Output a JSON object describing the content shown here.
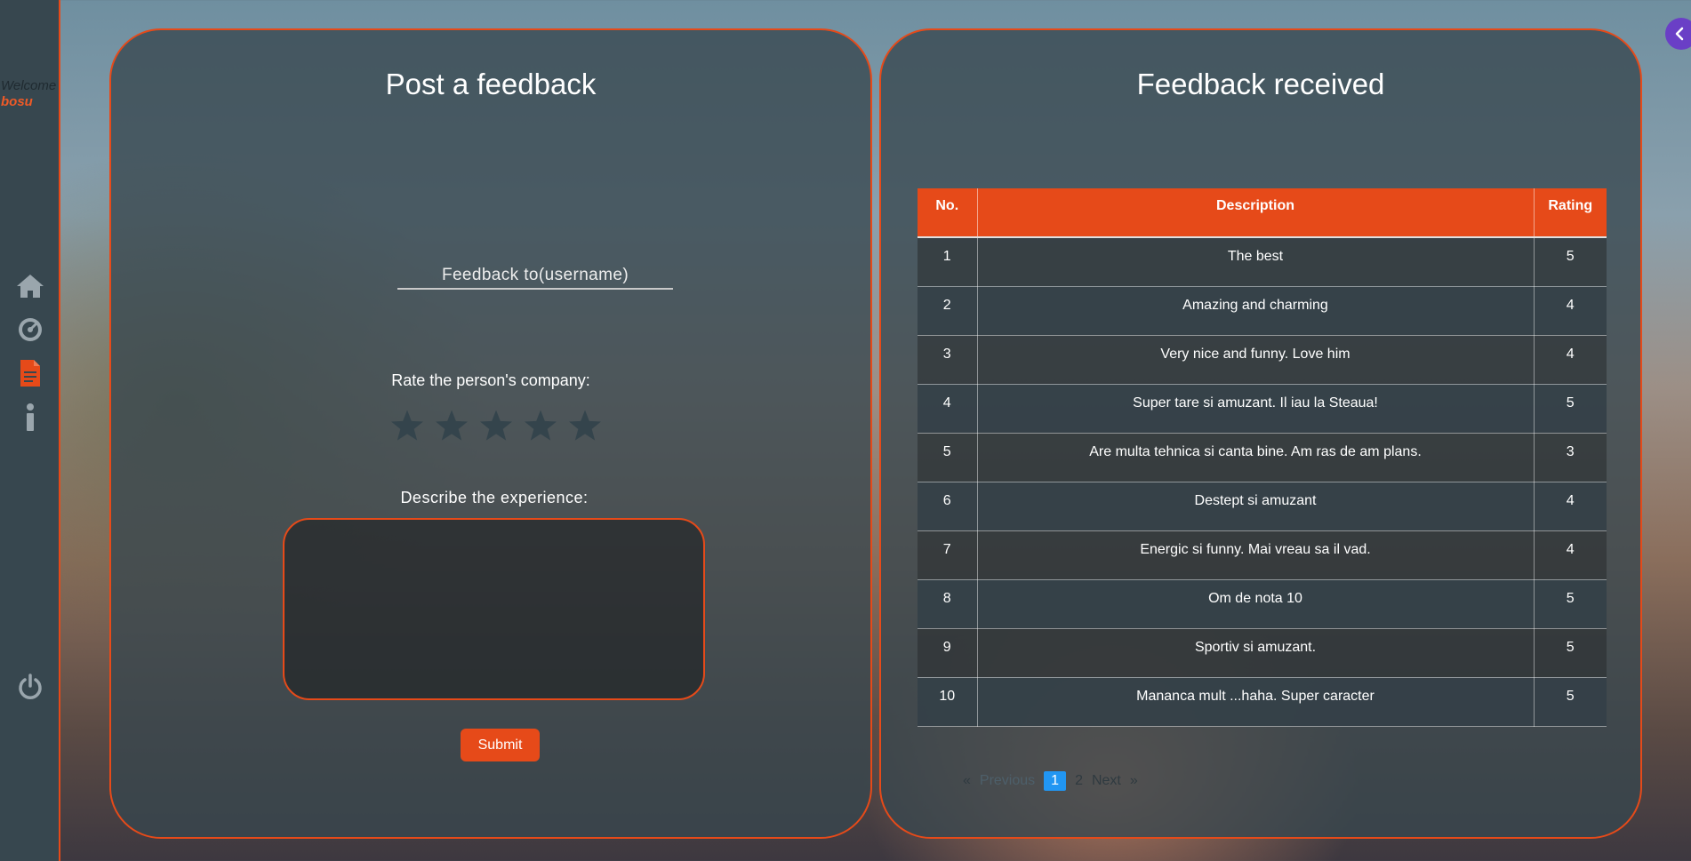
{
  "sidebar": {
    "welcome": "Welcome",
    "username": "bosu",
    "icons": [
      "home-icon",
      "dashboard-gauge-icon",
      "document-icon",
      "info-icon",
      "power-icon"
    ],
    "active_color": "#e64a19"
  },
  "post": {
    "title": "Post a feedback",
    "to_placeholder": "Feedback to(username)",
    "rate_label": "Rate the person's company:",
    "stars": 5,
    "describe_label": "Describe the experience:",
    "submit_label": "Submit"
  },
  "received": {
    "title": "Feedback received",
    "headers": {
      "no": "No.",
      "description": "Description",
      "rating": "Rating"
    },
    "rows": [
      {
        "no": "1",
        "description": "The best",
        "rating": "5"
      },
      {
        "no": "2",
        "description": "Amazing and charming",
        "rating": "4"
      },
      {
        "no": "3",
        "description": "Very nice and funny. Love him",
        "rating": "4"
      },
      {
        "no": "4",
        "description": "Super tare si amuzant. Il iau la Steaua!",
        "rating": "5"
      },
      {
        "no": "5",
        "description": "Are multa tehnica si canta bine. Am ras de am plans.",
        "rating": "3"
      },
      {
        "no": "6",
        "description": "Destept si amuzant",
        "rating": "4"
      },
      {
        "no": "7",
        "description": "Energic si funny. Mai vreau sa il vad.",
        "rating": "4"
      },
      {
        "no": "8",
        "description": "Om de nota 10",
        "rating": "5"
      },
      {
        "no": "9",
        "description": "Sportiv si amuzant.",
        "rating": "5"
      },
      {
        "no": "10",
        "description": "Mananca mult ...haha. Super caracter",
        "rating": "5"
      }
    ],
    "pagination": {
      "first": "«",
      "previous": "Previous",
      "pages": [
        "1",
        "2"
      ],
      "current": "1",
      "next": "Next",
      "last": "»"
    }
  },
  "colors": {
    "accent": "#e64a19",
    "sidebar": "#37474f",
    "pager_active": "#2196f3",
    "collapse_button": "#6a3fc6"
  }
}
